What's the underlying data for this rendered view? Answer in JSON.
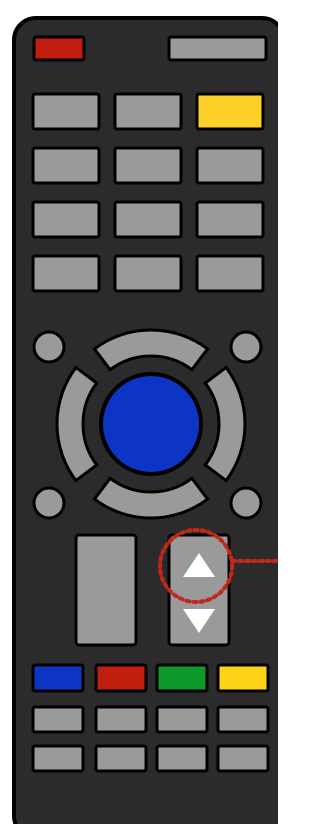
{
  "remote": {
    "colors": {
      "body": "#2b2b2b",
      "outline": "#000000",
      "button": "#9a9a9a",
      "power": "#c01e0e",
      "input_highlight": "#ffd02a",
      "ok": "#0b35c2",
      "blue": "#0b35c2",
      "red": "#c01e0e",
      "green": "#0e9a2a",
      "yellow": "#ffd21a",
      "arrow": "#ffffff",
      "highlight_ring": "#c0281a"
    },
    "top_row": [
      {
        "name": "power-button",
        "color": "power"
      },
      {
        "name": "function-button",
        "color": "button"
      }
    ],
    "keypad_rows": [
      [
        "button",
        "button",
        "input_highlight"
      ],
      [
        "button",
        "button",
        "button"
      ],
      [
        "button",
        "button",
        "button"
      ],
      [
        "button",
        "button",
        "button"
      ]
    ],
    "dpad": {
      "arrows": [
        "up",
        "right",
        "down",
        "left"
      ],
      "corner_buttons": [
        "top-left",
        "top-right",
        "bottom-left",
        "bottom-right"
      ]
    },
    "volume_rocker": {
      "label": ""
    },
    "channel_rocker": {
      "up_icon": "▲",
      "down_icon": "▼",
      "highlighted": "up"
    },
    "color_buttons": [
      "blue",
      "red",
      "green",
      "yellow"
    ],
    "bottom_rows": 2,
    "bottom_cols": 4
  }
}
